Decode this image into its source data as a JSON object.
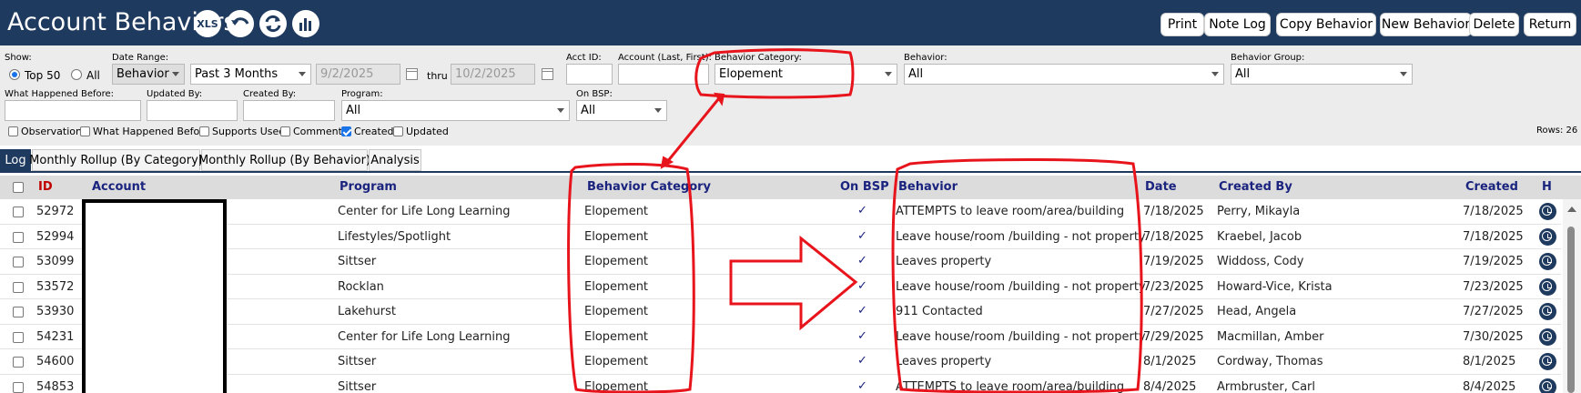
{
  "header": {
    "title": "Account Behaviors",
    "icons": [
      "xls-icon",
      "undo-icon",
      "refresh-icon",
      "chart-icon"
    ],
    "xls_label": "XLS",
    "buttons": [
      "Print",
      "Note Log",
      "Copy Behavior",
      "New Behavior",
      "Delete",
      "Return"
    ]
  },
  "filters": {
    "show_label": "Show:",
    "top50_label": "Top 50",
    "all_label": "All",
    "date_range_label": "Date Range:",
    "date_type": "Behavior",
    "date_preset": "Past 3 Months",
    "date_from": "9/2/2025",
    "thru_label": "thru",
    "date_to": "10/2/2025",
    "acct_id_label": "Acct ID:",
    "acct_id_value": "",
    "account_label": "Account (Last, First):",
    "account_value": "",
    "behavior_category_label": "Behavior Category:",
    "behavior_category_value": "Elopement",
    "behavior_label": "Behavior:",
    "behavior_value": "All",
    "behavior_group_label": "Behavior Group:",
    "behavior_group_value": "All",
    "what_happened_label": "What Happened Before:",
    "updated_by_label": "Updated By:",
    "created_by_label": "Created By:",
    "program_label": "Program:",
    "program_value": "All",
    "on_bsp_label": "On BSP:",
    "on_bsp_value": "All",
    "checkboxes": [
      {
        "label": "Observation",
        "checked": false
      },
      {
        "label": "What Happened Before",
        "checked": false
      },
      {
        "label": "Supports Used",
        "checked": false
      },
      {
        "label": "Comment",
        "checked": false
      },
      {
        "label": "Created",
        "checked": true
      },
      {
        "label": "Updated",
        "checked": false
      }
    ],
    "rows_count": "Rows: 26"
  },
  "tabs": [
    "Log",
    "Monthly Rollup (By Category)",
    "Monthly Rollup (By Behavior)",
    "Analysis"
  ],
  "grid": {
    "columns": {
      "id": "ID",
      "account": "Account",
      "program": "Program",
      "behavior_category": "Behavior Category",
      "on_bsp": "On BSP",
      "behavior": "Behavior",
      "date": "Date",
      "created_by": "Created By",
      "created": "Created",
      "h": "H"
    },
    "check_glyph": "✓",
    "rows": [
      {
        "id": "52972",
        "program": "Center for Life Long Learning",
        "category": "Elopement",
        "behavior": "ATTEMPTS to leave room/area/building",
        "date": "7/18/2025",
        "created_by": "Perry, Mikayla",
        "created": "7/18/2025"
      },
      {
        "id": "52994",
        "program": "Lifestyles/Spotlight",
        "category": "Elopement",
        "behavior": "Leave house/room /building - not property",
        "date": "7/18/2025",
        "created_by": "Kraebel, Jacob",
        "created": "7/18/2025"
      },
      {
        "id": "53099",
        "program": "Sittser",
        "category": "Elopement",
        "behavior": "Leaves property",
        "date": "7/19/2025",
        "created_by": "Widdoss, Cody",
        "created": "7/19/2025"
      },
      {
        "id": "53572",
        "program": "Rocklan",
        "category": "Elopement",
        "behavior": "Leave house/room /building - not property",
        "date": "7/23/2025",
        "created_by": "Howard-Vice, Krista",
        "created": "7/23/2025"
      },
      {
        "id": "53930",
        "program": "Lakehurst",
        "category": "Elopement",
        "behavior": "911 Contacted",
        "date": "7/27/2025",
        "created_by": "Head, Angela",
        "created": "7/27/2025"
      },
      {
        "id": "54231",
        "program": "Center for Life Long Learning",
        "category": "Elopement",
        "behavior": "Leave house/room /building - not property",
        "date": "7/29/2025",
        "created_by": "Macmillan, Amber",
        "created": "7/30/2025"
      },
      {
        "id": "54600",
        "program": "Sittser",
        "category": "Elopement",
        "behavior": "Leaves property",
        "date": "8/1/2025",
        "created_by": "Cordway, Thomas",
        "created": "8/1/2025"
      },
      {
        "id": "54853",
        "program": "Sittser",
        "category": "Elopement",
        "behavior": "ATTEMPTS to leave room/area/building",
        "date": "8/4/2025",
        "created_by": "Armbruster, Carl",
        "created": "8/4/2025"
      }
    ]
  },
  "colors": {
    "header_bg": "#1f3a5f",
    "annotation_red": "#e8141c"
  }
}
